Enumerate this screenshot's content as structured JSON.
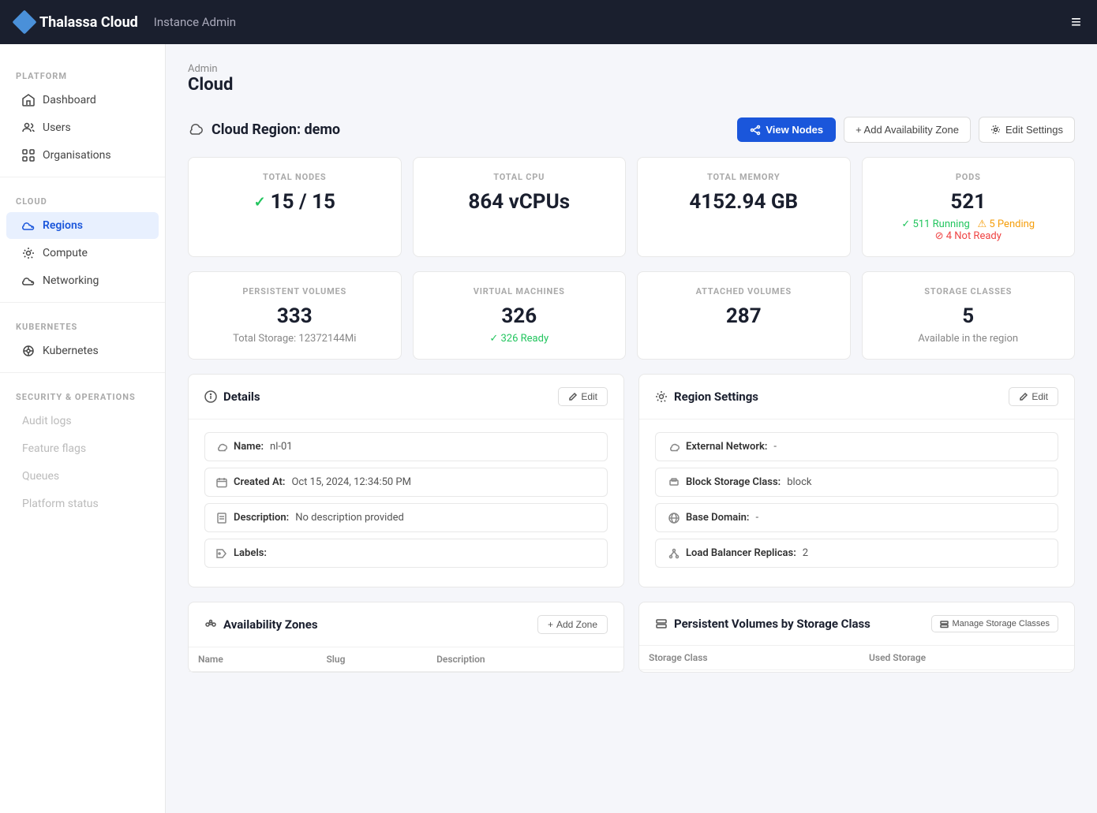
{
  "header": {
    "logo_text": "Thalassa Cloud",
    "instance_label": "Instance Admin",
    "menu_icon": "≡"
  },
  "breadcrumb": {
    "parent": "Admin",
    "current": "Cloud"
  },
  "sidebar": {
    "sections": [
      {
        "label": "PLATFORM",
        "items": [
          {
            "id": "dashboard",
            "label": "Dashboard",
            "icon": "home"
          },
          {
            "id": "users",
            "label": "Users",
            "icon": "users"
          },
          {
            "id": "organisations",
            "label": "Organisations",
            "icon": "grid"
          }
        ]
      },
      {
        "label": "CLOUD",
        "items": [
          {
            "id": "regions",
            "label": "Regions",
            "icon": "cloud",
            "active": true
          },
          {
            "id": "compute",
            "label": "Compute",
            "icon": "gear"
          },
          {
            "id": "networking",
            "label": "Networking",
            "icon": "cloud2"
          }
        ]
      },
      {
        "label": "KUBERNETES",
        "items": [
          {
            "id": "kubernetes",
            "label": "Kubernetes",
            "icon": "kube"
          }
        ]
      },
      {
        "label": "SECURITY & OPERATIONS",
        "items": [
          {
            "id": "audit-logs",
            "label": "Audit logs",
            "icon": "",
            "disabled": true
          },
          {
            "id": "feature-flags",
            "label": "Feature flags",
            "icon": "",
            "disabled": true
          },
          {
            "id": "queues",
            "label": "Queues",
            "icon": "",
            "disabled": true
          },
          {
            "id": "platform-status",
            "label": "Platform status",
            "icon": "",
            "disabled": true
          }
        ]
      }
    ]
  },
  "region": {
    "title": "Cloud Region: demo",
    "view_nodes_btn": "View Nodes",
    "add_zone_btn": "+ Add Availability Zone",
    "edit_settings_btn": "Edit Settings"
  },
  "stats": {
    "total_nodes": {
      "label": "TOTAL NODES",
      "value": "15 / 15",
      "check": true
    },
    "total_cpu": {
      "label": "TOTAL CPU",
      "value": "864 vCPUs"
    },
    "total_memory": {
      "label": "TOTAL MEMORY",
      "value": "4152.94 GB"
    },
    "pods": {
      "label": "PODS",
      "value": "521",
      "running": "511 Running",
      "pending": "5 Pending",
      "not_ready": "4 Not Ready"
    },
    "persistent_volumes": {
      "label": "PERSISTENT VOLUMES",
      "value": "333",
      "sub": "Total Storage: 12372144Mi"
    },
    "virtual_machines": {
      "label": "VIRTUAL MACHINES",
      "value": "326",
      "ready": "326 Ready"
    },
    "attached_volumes": {
      "label": "ATTACHED VOLUMES",
      "value": "287"
    },
    "storage_classes": {
      "label": "STORAGE CLASSES",
      "value": "5",
      "sub": "Available in the region"
    }
  },
  "details": {
    "title": "Details",
    "edit_btn": "Edit",
    "name_label": "Name:",
    "name_value": "nl-01",
    "created_label": "Created At:",
    "created_value": "Oct 15, 2024, 12:34:50 PM",
    "description_label": "Description:",
    "description_value": "No description provided",
    "labels_label": "Labels:"
  },
  "region_settings": {
    "title": "Region Settings",
    "edit_btn": "Edit",
    "external_network_label": "External Network:",
    "external_network_value": "-",
    "block_storage_label": "Block Storage Class:",
    "block_storage_value": "block",
    "base_domain_label": "Base Domain:",
    "base_domain_value": "-",
    "load_balancer_label": "Load Balancer Replicas:",
    "load_balancer_value": "2"
  },
  "availability_zones": {
    "title": "Availability Zones",
    "add_btn": "Add Zone",
    "columns": [
      "Name",
      "Slug",
      "Description"
    ],
    "rows": []
  },
  "persistent_volumes": {
    "title": "Persistent Volumes by Storage Class",
    "manage_btn": "Manage Storage Classes",
    "columns": [
      "Storage Class",
      "Used Storage"
    ],
    "rows": []
  }
}
